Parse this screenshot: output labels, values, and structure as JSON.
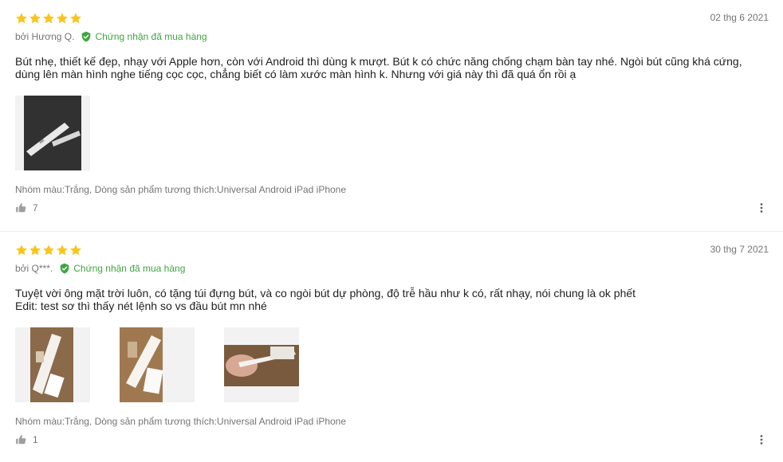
{
  "colors": {
    "star": "#f8c51c",
    "verified": "#40a540",
    "meta_text": "#757575",
    "body_text": "#212121",
    "divider": "#eeeeee"
  },
  "reviews": [
    {
      "rating": 5,
      "date": "02 thg 6 2021",
      "author": "bởi Hương Q.",
      "verified_label": "Chứng nhận đã mua hàng",
      "content_lines": [
        "Bút nhẹ, thiết kế đẹp, nhạy với Apple hơn, còn với Android thì dùng k mượt. Bút k có chức năng chống chạm bàn tay nhé. Ngòi bút cũng khá cứng,",
        "dùng lên màn hình nghe tiếng cọc cọc, chẳng biết có làm xước màn hình k. Nhưng với giá này thì đã quá ổn rồi ạ"
      ],
      "image_count": 1,
      "sku": "Nhóm màu:Trắng, Dòng sản phẩm tương thích:Universal Android iPad iPhone",
      "likes": "7"
    },
    {
      "rating": 5,
      "date": "30 thg 7 2021",
      "author": "bởi Q***.",
      "verified_label": "Chứng nhận đã mua hàng",
      "content_lines": [
        "Tuyệt vời ông mặt trời luôn, có tặng túi đựng bút, và co ngòi bút dự phòng, độ trễ hầu như k có, rất nhạy, nói chung là ok phết",
        "Edit: test sơ thì thấy nét lệnh so vs đầu bút mn nhé"
      ],
      "image_count": 3,
      "sku": "Nhóm màu:Trắng, Dòng sản phẩm tương thích:Universal Android iPad iPhone",
      "likes": "1"
    }
  ],
  "icons": {
    "star": "star-icon",
    "verified": "verified-shield-icon",
    "like": "thumbs-up-icon",
    "more": "more-vertical-icon"
  }
}
